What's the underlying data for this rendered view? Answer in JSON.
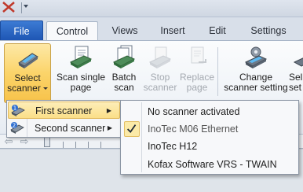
{
  "tabs": {
    "file": "File",
    "control": "Control",
    "views": "Views",
    "insert": "Insert",
    "edit": "Edit",
    "settings": "Settings"
  },
  "ribbon": {
    "select_scanner": [
      "Select",
      "scanner"
    ],
    "scan_single_page": [
      "Scan single",
      "page"
    ],
    "batch_scan": [
      "Batch",
      "scan"
    ],
    "stop_scanner": [
      "Stop",
      "scanner"
    ],
    "replace_page": [
      "Replace",
      "page"
    ],
    "change_scanner_setting": [
      "Change",
      "scanner setting"
    ],
    "partial_button": [
      "Sel",
      "set"
    ]
  },
  "scanner_menu": {
    "items": [
      {
        "label": "First scanner",
        "icon": "scanner-1-icon",
        "highlighted": true
      },
      {
        "label": "Second scanner",
        "icon": "scanner-2-icon",
        "highlighted": false
      }
    ]
  },
  "scanner_submenu": {
    "items": [
      {
        "label": "No scanner activated",
        "checked": false
      },
      {
        "label": "InoTec M06 Ethernet",
        "checked": true
      },
      {
        "label": "InoTec H12",
        "checked": false
      },
      {
        "label": "Kofax Software VRS - TWAIN",
        "checked": false
      }
    ]
  },
  "colors": {
    "file_tab": "#1e56b4",
    "highlight": "#fbd46a"
  }
}
